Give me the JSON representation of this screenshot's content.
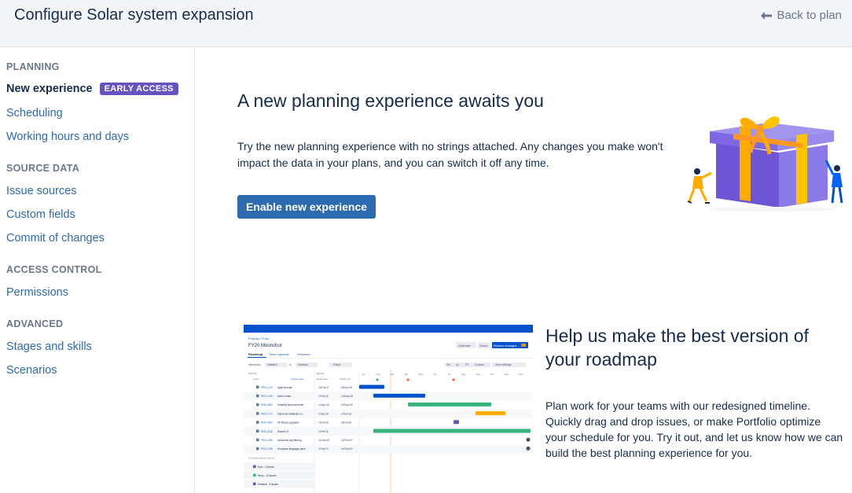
{
  "header": {
    "title": "Configure Solar system expansion",
    "back_label": "Back to plan"
  },
  "sidebar": {
    "sections": [
      {
        "heading": "PLANNING",
        "items": [
          {
            "label": "New experience",
            "badge": "EARLY ACCESS",
            "active": true
          },
          {
            "label": "Scheduling"
          },
          {
            "label": "Working hours and days"
          }
        ]
      },
      {
        "heading": "SOURCE DATA",
        "items": [
          {
            "label": "Issue sources"
          },
          {
            "label": "Custom fields"
          },
          {
            "label": "Commit of changes"
          }
        ]
      },
      {
        "heading": "ACCESS CONTROL",
        "items": [
          {
            "label": "Permissions"
          }
        ]
      },
      {
        "heading": "ADVANCED",
        "items": [
          {
            "label": "Stages and skills"
          },
          {
            "label": "Scenarios"
          }
        ]
      }
    ]
  },
  "main": {
    "heading": "A new planning experience awaits you",
    "description": "Try the new planning experience with no strings attached. Any changes you make won't impact the data in your plans, and you can switch it off any time.",
    "cta_label": "Enable new experience",
    "heading2": "Help us make the best version of your roadmap",
    "description2": "Plan work for your teams with our redesigned timeline. Quickly drag and drop issues, or make Portfolio optimize your schedule for you. Try it out, and let us know how we can build the best planning experience for you."
  },
  "preview": {
    "breadcrumb": "Portfolio / Plan",
    "plan_title": "FY20 Moonshot",
    "tabs": [
      "Roadmap",
      "Team capacity",
      "Releases"
    ],
    "buttons": [
      "Optimize",
      "Share",
      "Review changes"
    ],
    "review_count": "8",
    "toolbar": {
      "hierarchy": "Hierarchy:",
      "from": "Initiative",
      "to_word": "to",
      "to": "Subtask",
      "filters": "Filters",
      "zoom": [
        "3m",
        "1y",
        "FY",
        "Custom"
      ],
      "view_settings": "View settings"
    },
    "columns": [
      "SCOPE",
      "FIELDS",
      "Issue",
      "Target start",
      "Target end"
    ],
    "create_issue": "Create issue",
    "months": [
      "Jan",
      "Feb",
      "Mar",
      "Apr",
      "May",
      "Jun",
      "Jul",
      "Aug",
      "Sep",
      "Oct",
      "Nov",
      "Dec"
    ],
    "rows": [
      {
        "key": "PROJ-123",
        "title": "Agile at scale",
        "start": "20/Oct/17",
        "end": "28/Jan/18"
      },
      {
        "key": "PROJ-245",
        "title": "Data Center",
        "start": "1/Feb/18",
        "end": "10/May/18"
      },
      {
        "key": "RND-3002",
        "title": "Usability improvements",
        "start": "14/Apr/18",
        "end": "30/Sep/18"
      },
      {
        "key": "PROJ-271",
        "title": "Improved database su...",
        "start": "1/Sep/18",
        "end": "1/Nov/18"
      },
      {
        "key": "RND-3391",
        "title": "FE library upgrades",
        "start": "16/Jul/18",
        "end": "28/Jul/18"
      },
      {
        "key": "RND-3133",
        "title": "Search v2",
        "start": "1/Feb/18",
        "end": ""
      },
      {
        "key": "PROJ-396",
        "title": "Advanced log filtering",
        "start": "14/Jan/19",
        "end": "31/Feb/19"
      },
      {
        "key": "PROJ-395",
        "title": "European language pack",
        "start": "2/Feb/19",
        "end": "31/Feb/19"
      }
    ],
    "without_parent": "19 issues without parent",
    "groups": [
      "Epic - 4 issues",
      "Story - 12 issues",
      "Subtask - 3 issues"
    ]
  },
  "colors": {
    "accent": "#2d6bb0",
    "badge": "#6554c0",
    "bar_blue": "#0052cc",
    "bar_green": "#36b37e",
    "bar_orange": "#ffab00",
    "bar_purple": "#6554c0",
    "milestone_red": "#ff5630",
    "today_line": "#ff8b6a"
  }
}
